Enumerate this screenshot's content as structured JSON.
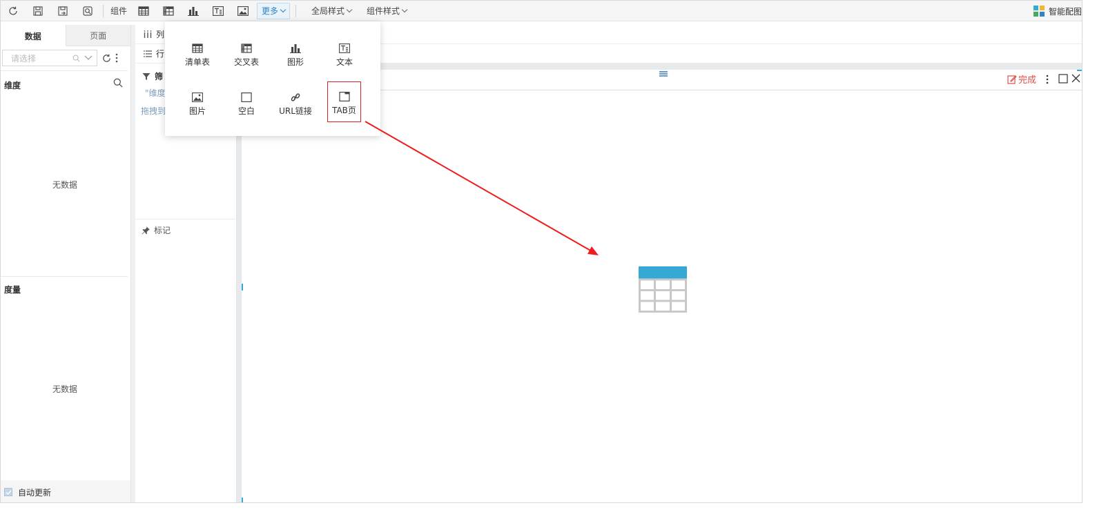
{
  "toolbar": {
    "component_label": "组件",
    "more_label": "更多",
    "global_style_label": "全局样式",
    "component_style_label": "组件样式",
    "brand_label": "智能配图"
  },
  "left_panel": {
    "tabs": [
      {
        "label": "数据",
        "active": true
      },
      {
        "label": "页面",
        "active": false
      }
    ],
    "select_placeholder": "请选择",
    "dimension_title": "维度",
    "dimension_empty": "无数据",
    "measure_title": "度量",
    "measure_empty": "无数据",
    "auto_update_label": "自动更新"
  },
  "middle_panel": {
    "column_label": "列",
    "row_label": "行",
    "filter_label": "筛",
    "filter_hint1": "\"维度",
    "filter_hint2": "拖拽到",
    "mark_label": "标记"
  },
  "widget": {
    "done_label": "完成"
  },
  "more_menu": {
    "items": [
      {
        "label": "清单表",
        "icon": "list-table-icon"
      },
      {
        "label": "交叉表",
        "icon": "cross-table-icon"
      },
      {
        "label": "图形",
        "icon": "bar-chart-icon"
      },
      {
        "label": "文本",
        "icon": "text-icon"
      },
      {
        "label": "图片",
        "icon": "image-icon"
      },
      {
        "label": "空白",
        "icon": "blank-icon"
      },
      {
        "label": "URL链接",
        "icon": "link-icon"
      },
      {
        "label": "TAB页",
        "icon": "tab-page-icon",
        "highlighted": true
      }
    ]
  },
  "colors": {
    "accent": "#2f83c8",
    "highlight": "#e02020",
    "done_red": "#e24c43",
    "placeholder_blue": "#35a8d4"
  }
}
